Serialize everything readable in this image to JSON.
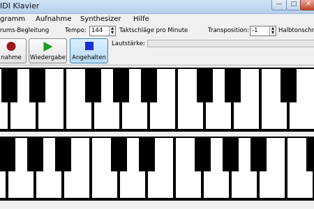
{
  "window": {
    "title": "IDI Klavier"
  },
  "menu": {
    "items": [
      "gramm",
      "Aufnahme",
      "Synthesizer",
      "Hilfe"
    ]
  },
  "controls": {
    "drums_label": "rums-Begleitung",
    "tempo_label": "Tempo:",
    "tempo_value": "144",
    "tempo_unit": "Taktschläge pro Minute",
    "transposition_label": "Transposition:",
    "transposition_value": "-1",
    "transposition_unit": "Halbtonschrit"
  },
  "toolbar": {
    "record_label": "nahme",
    "play_label": "Wiedergabe",
    "stop_label": "Angehalten",
    "volume_label": "Lautstärke:"
  },
  "colors": {
    "record": "#9b1a1a",
    "play": "#1e9a2b",
    "stop": "#1b2fd6",
    "active_button": "#b8dcf7"
  },
  "keyboard": {
    "upper_black_keys": [
      0,
      1,
      3,
      4,
      5,
      7,
      8,
      10
    ],
    "lower_black_keys": [
      0,
      1,
      2,
      4,
      5,
      7,
      8,
      9,
      11
    ]
  }
}
